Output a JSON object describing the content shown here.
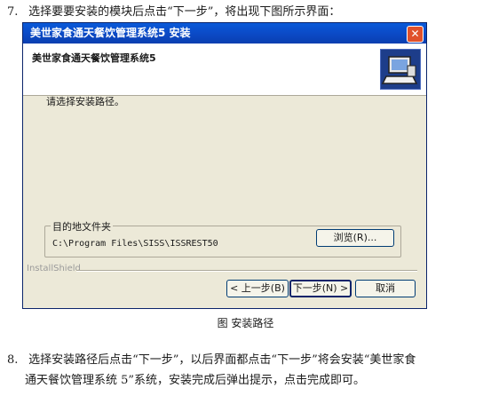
{
  "step7": {
    "number": "7.",
    "text": "选择要要安装的模块后点击“下一步”，将出现下图所示界面："
  },
  "dialog": {
    "title": "美世家食通天餐饮管理系统5 安装",
    "close_symbol": "✕",
    "header_title": "美世家食通天餐饮管理系统5",
    "logo_icon": "installer-computer-icon",
    "prompt": "请选择安装路径。",
    "group_label": "目的地文件夹",
    "path": "C:\\Program Files\\SISS\\ISSREST50",
    "browse_label": "浏览(R)...",
    "installshield": "InstallShield",
    "back_label": "< 上一步(B)",
    "next_label": "下一步(N) >",
    "cancel_label": "取消"
  },
  "caption": "图 安装路径",
  "step8": {
    "number": "8.",
    "line1": "选择安装路径后点击“下一步”，以后界面都点击“下一步”将会安装“美世家食",
    "line2": "通天餐饮管理系统 5”系统，安装完成后弹出提示，点击完成即可。"
  },
  "colors": {
    "titlebar": "#0b49c5",
    "dialog_bg": "#ece9d8",
    "close_button": "#e0512c"
  }
}
